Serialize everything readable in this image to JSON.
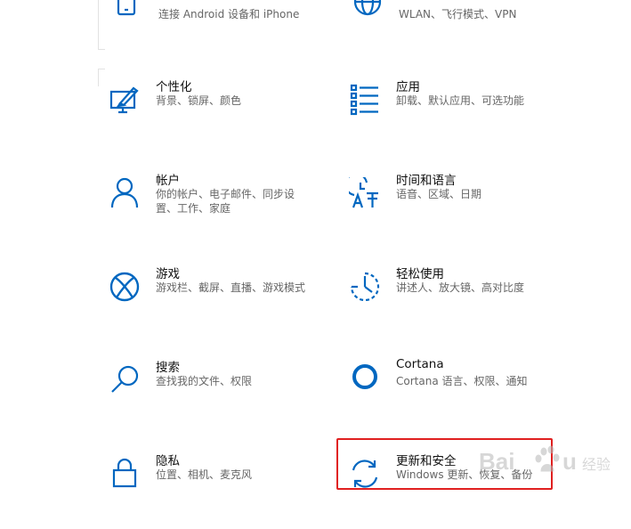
{
  "accent_color": "#0067c0",
  "highlight_color": "#e02020",
  "tiles": [
    {
      "icon": "phone-icon",
      "title": "",
      "desc": "连接 Android 设备和 iPhone"
    },
    {
      "icon": "globe-icon",
      "title": "",
      "desc": "WLAN、飞行模式、VPN"
    },
    {
      "icon": "personalization-icon",
      "title": "个性化",
      "desc": "背景、锁屏、颜色"
    },
    {
      "icon": "apps-list-icon",
      "title": "应用",
      "desc": "卸载、默认应用、可选功能"
    },
    {
      "icon": "person-icon",
      "title": "帐户",
      "desc": "你的帐户、电子邮件、同步设置、工作、家庭"
    },
    {
      "icon": "time-language-icon",
      "title": "时间和语言",
      "desc": "语音、区域、日期"
    },
    {
      "icon": "xbox-icon",
      "title": "游戏",
      "desc": "游戏栏、截屏、直播、游戏模式"
    },
    {
      "icon": "ease-of-access-icon",
      "title": "轻松使用",
      "desc": "讲述人、放大镜、高对比度"
    },
    {
      "icon": "search-icon",
      "title": "搜索",
      "desc": "查找我的文件、权限"
    },
    {
      "icon": "cortana-icon",
      "title": "Cortana",
      "desc": "Cortana 语言、权限、通知"
    },
    {
      "icon": "lock-icon",
      "title": "隐私",
      "desc": "位置、相机、麦克风"
    },
    {
      "icon": "update-sync-icon",
      "title": "更新和安全",
      "desc": "Windows 更新、恢复、备份"
    }
  ],
  "watermark": {
    "brand_logo": "Baidu",
    "sub_text": "经验"
  }
}
